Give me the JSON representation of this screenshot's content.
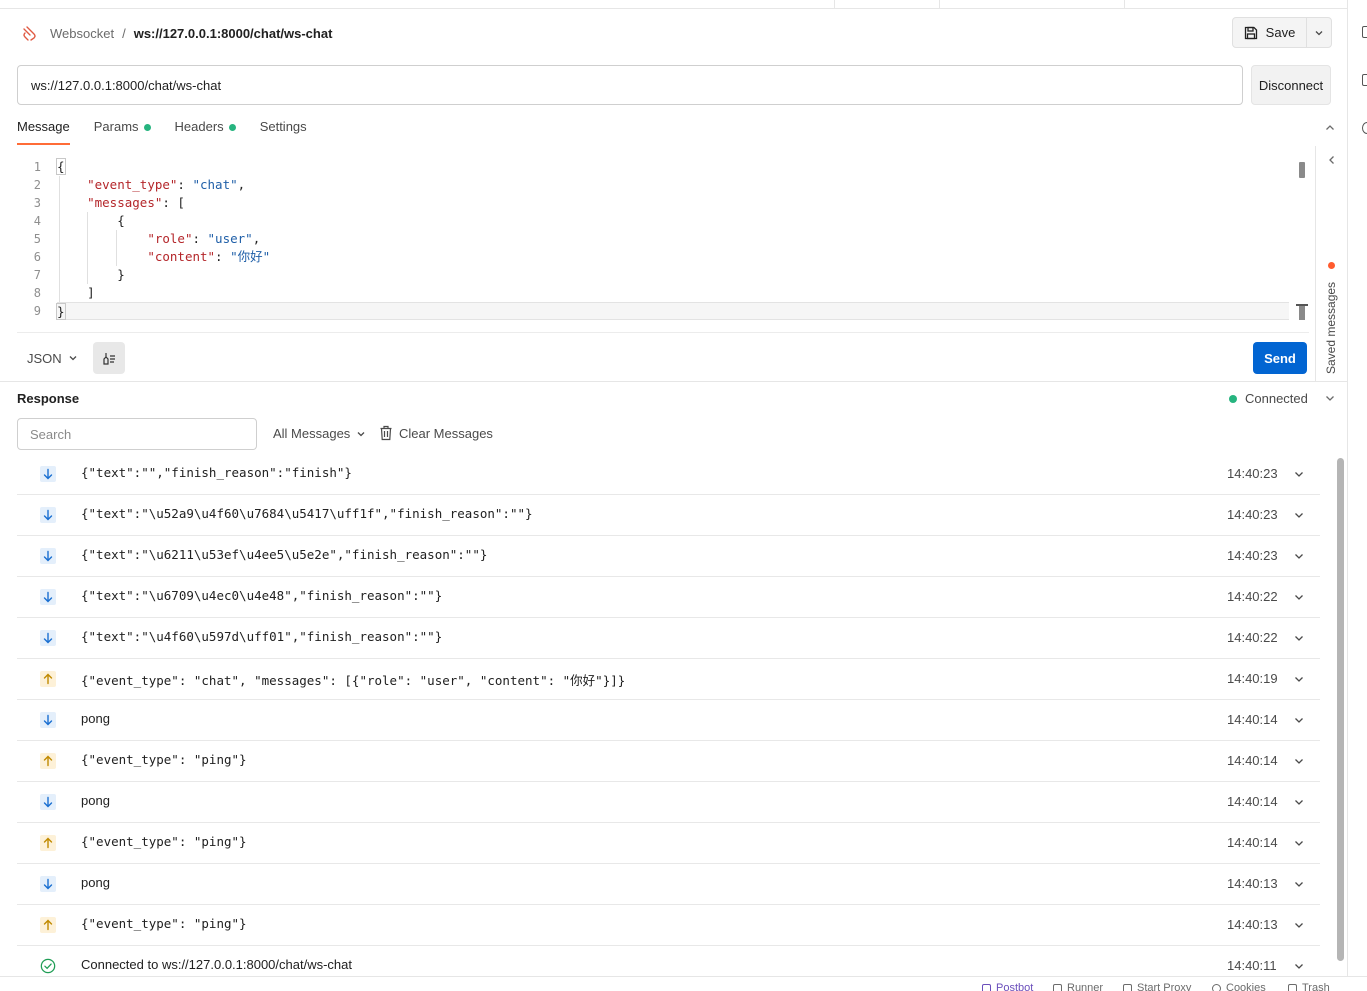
{
  "header": {
    "breadcrumb_parent": "Websocket",
    "breadcrumb_separator": "/",
    "breadcrumb_current": "ws://127.0.0.1:8000/chat/ws-chat",
    "save_label": "Save"
  },
  "url_bar": {
    "value": "ws://127.0.0.1:8000/chat/ws-chat",
    "disconnect_label": "Disconnect"
  },
  "tabs": [
    {
      "label": "Message",
      "active": true,
      "dot": false
    },
    {
      "label": "Params",
      "active": false,
      "dot": true
    },
    {
      "label": "Headers",
      "active": false,
      "dot": true
    },
    {
      "label": "Settings",
      "active": false,
      "dot": false
    }
  ],
  "editor": {
    "line_numbers": [
      "1",
      "2",
      "3",
      "4",
      "5",
      "6",
      "7",
      "8",
      "9"
    ],
    "format_label": "JSON",
    "send_label": "Send",
    "saved_messages_label": "Saved messages"
  },
  "response": {
    "title": "Response",
    "status_text": "Connected",
    "status_color": "#26b47f",
    "search_placeholder": "Search",
    "filter_label": "All Messages",
    "clear_label": "Clear Messages",
    "messages": [
      {
        "dir": "in",
        "text": "{\"text\":\"\",\"finish_reason\":\"finish\"}",
        "time": "14:40:23"
      },
      {
        "dir": "in",
        "text": "{\"text\":\"\\u52a9\\u4f60\\u7684\\u5417\\uff1f\",\"finish_reason\":\"\"}",
        "time": "14:40:23"
      },
      {
        "dir": "in",
        "text": "{\"text\":\"\\u6211\\u53ef\\u4ee5\\u5e2e\",\"finish_reason\":\"\"}",
        "time": "14:40:23"
      },
      {
        "dir": "in",
        "text": "{\"text\":\"\\u6709\\u4ec0\\u4e48\",\"finish_reason\":\"\"}",
        "time": "14:40:22"
      },
      {
        "dir": "in",
        "text": "{\"text\":\"\\u4f60\\u597d\\uff01\",\"finish_reason\":\"\"}",
        "time": "14:40:22"
      },
      {
        "dir": "out",
        "text": "{\"event_type\": \"chat\", \"messages\": [{\"role\": \"user\", \"content\": \"你好\"}]}",
        "time": "14:40:19"
      },
      {
        "dir": "in",
        "text": "pong",
        "time": "14:40:14"
      },
      {
        "dir": "out",
        "text": "{\"event_type\": \"ping\"}",
        "time": "14:40:14"
      },
      {
        "dir": "in",
        "text": "pong",
        "time": "14:40:14"
      },
      {
        "dir": "out",
        "text": "{\"event_type\": \"ping\"}",
        "time": "14:40:14"
      },
      {
        "dir": "in",
        "text": "pong",
        "time": "14:40:13"
      },
      {
        "dir": "out",
        "text": "{\"event_type\": \"ping\"}",
        "time": "14:40:13"
      },
      {
        "dir": "conn",
        "text": "Connected to ws://127.0.0.1:8000/chat/ws-chat",
        "time": "14:40:11"
      }
    ]
  },
  "status_bar": {
    "postbot": "Postbot",
    "runner": "Runner",
    "start_proxy": "Start Proxy",
    "cookies": "Cookies",
    "trash": "Trash"
  },
  "colors": {
    "accent": "#ff6c37",
    "send": "#0265d2",
    "incoming_bg": "#e4effb",
    "outgoing_bg": "#fdf1d8"
  }
}
